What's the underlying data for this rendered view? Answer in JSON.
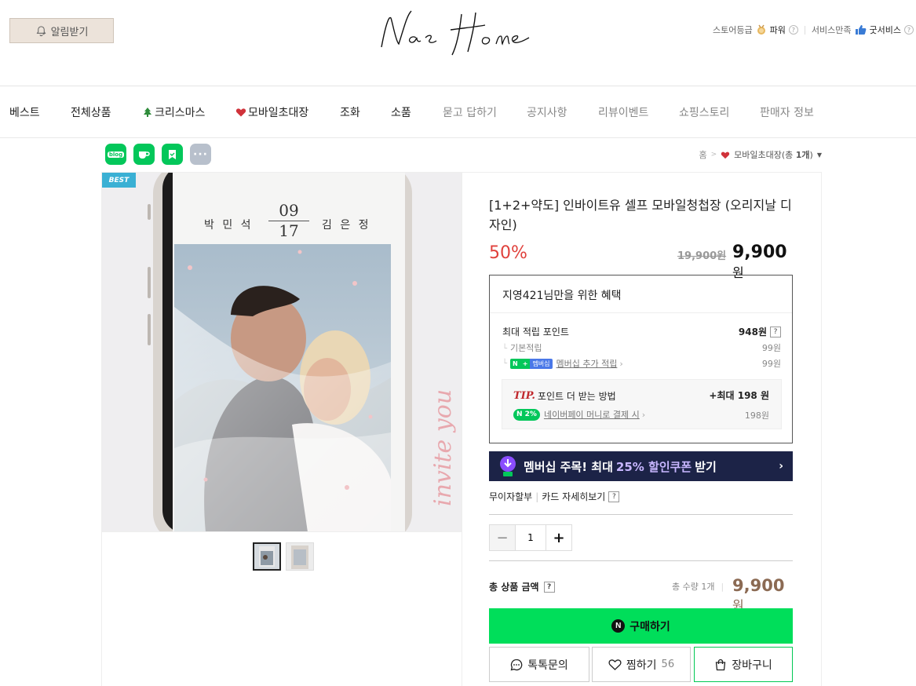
{
  "header": {
    "alarm_label": "알림받기",
    "store_grade_label": "스토어등급",
    "store_grade_value": "파워",
    "service_label": "서비스만족",
    "service_value": "굿서비스"
  },
  "nav": [
    {
      "label": "베스트"
    },
    {
      "label": "전체상품"
    },
    {
      "label": "크리스마스",
      "icon": "tree-icon"
    },
    {
      "label": "모바일초대장",
      "icon": "heart-icon"
    },
    {
      "label": "조화"
    },
    {
      "label": "소품"
    },
    {
      "label": "묻고 답하기"
    },
    {
      "label": "공지사항"
    },
    {
      "label": "리뷰이벤트"
    },
    {
      "label": "쇼핑스토리"
    },
    {
      "label": "판매자 정보"
    }
  ],
  "share": {
    "blog": "blog",
    "more": "···"
  },
  "breadcrumb": {
    "home": "홈",
    "category": "모바일초대장",
    "count_prefix": "(총 ",
    "count": "1개",
    "count_suffix": ")"
  },
  "image": {
    "badge": "BEST",
    "name_left": "박 민 석",
    "name_right": "김 은 정",
    "date_top": "09",
    "date_bottom": "17",
    "script": "invite you"
  },
  "product": {
    "title": "[1+2+약도] 인바이트유 셀프 모바일청첩장 (오리지날 디자인)",
    "discount": "50%",
    "original_price": "19,900원",
    "price": "9,900",
    "won": "원"
  },
  "benefit": {
    "header": "지영421님만을 위한 혜택",
    "max_points_label": "최대 적립 포인트",
    "max_points_value": "948원",
    "base_label": "기본적립",
    "base_value": "99원",
    "membership_pill_n": "N",
    "membership_pill_label": "멤버십",
    "membership_label": "멤버십 추가 적립",
    "membership_value": "99원",
    "tip_label": "TIP.",
    "tip_text": "포인트 더 받는 방법",
    "tip_value": "+최대 198 원",
    "npay_badge": "N 2%",
    "npay_text": "네이버페이 머니로 결제 시",
    "npay_value": "198원"
  },
  "coupon": {
    "prefix": "멤버십 주목! 최대",
    "highlight": "25% 할인쿠폰",
    "suffix": "받기"
  },
  "card": {
    "installment": "무이자할부",
    "details": "카드 자세히보기"
  },
  "quantity": {
    "value": "1"
  },
  "total": {
    "label": "총 상품 금액",
    "count": "총 수량 1개",
    "price": "9,900",
    "won": "원"
  },
  "actions": {
    "buy": "구매하기",
    "talk": "톡톡문의",
    "wish": "찜하기",
    "wish_count": "56",
    "cart": "장바구니"
  },
  "colors": {
    "accent_green": "#00de5a",
    "discount_red": "#e0413c",
    "banner_navy": "#1c2347"
  }
}
